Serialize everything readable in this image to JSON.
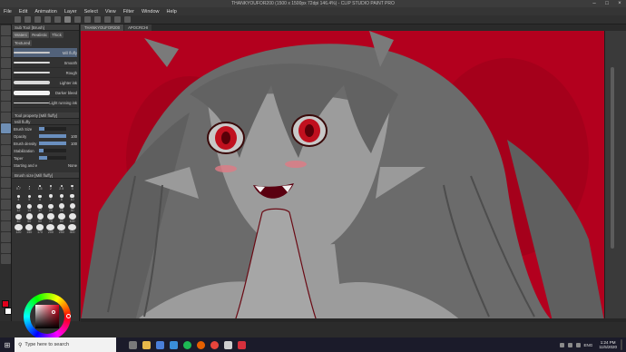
{
  "window": {
    "title": "THANKYOUFOR200 (1500 x 1500px 72dpi 146.4%) - CLIP STUDIO PAINT PRO",
    "controls": [
      "minimize-icon",
      "maximize-icon",
      "close-icon"
    ]
  },
  "menu": [
    "File",
    "Edit",
    "Animation",
    "Layer",
    "Select",
    "View",
    "Filter",
    "Window",
    "Help"
  ],
  "subtool_panel": {
    "header": "Sub Tool [Brush]",
    "tabs": [
      "Waterc",
      "Realistic",
      "Thick",
      "Textured"
    ],
    "brushes": [
      {
        "name": "Mill fluffy",
        "selected": true
      },
      {
        "name": "Smooth",
        "selected": false
      },
      {
        "name": "Rough",
        "selected": false
      },
      {
        "name": "Lighter ink",
        "selected": false
      },
      {
        "name": "Darker bleed",
        "selected": false
      },
      {
        "name": "Light running ink",
        "selected": false
      }
    ]
  },
  "tool_property": {
    "header": "Tool property [Mill fluffy]",
    "subheader": "Mill fluffy",
    "props": [
      {
        "label": "Brush Size",
        "value": "",
        "level": 0.2
      },
      {
        "label": "Opacity",
        "value": "100",
        "level": 1.0
      },
      {
        "label": "Brush density",
        "value": "100",
        "level": 1.0
      },
      {
        "label": "Stabilization",
        "value": "",
        "level": 0.15
      },
      {
        "label": "Taper",
        "value": "",
        "level": 0.3
      },
      {
        "label": "Starting and ending",
        "value": "None",
        "level": 0.0
      }
    ]
  },
  "brush_size_panel": {
    "header": "Brush size [Mill fluffy]",
    "sizes": [
      "0.7",
      "1",
      "1.5",
      "2",
      "2.5",
      "3",
      "4",
      "5",
      "6",
      "7",
      "8",
      "10",
      "12",
      "15",
      "17",
      "20",
      "25",
      "30",
      "40",
      "50",
      "60",
      "70",
      "80",
      "100",
      "120",
      "150",
      "170",
      "200",
      "250",
      "300"
    ]
  },
  "document_tabs": [
    "THANKYOUFOR200",
    "APOCRCHI"
  ],
  "colors": {
    "main": "#e0001c",
    "sub": "#ffffff",
    "canvas_bg": "#b3001e"
  },
  "taskbar": {
    "search_placeholder": "Type here to search",
    "apps": [
      "file-explorer-icon",
      "store-icon",
      "mail-icon",
      "spotify-icon",
      "firefox-icon",
      "chrome-icon",
      "app-icon",
      "clip-studio-icon"
    ],
    "language": "ENG",
    "time": "1:24 PM",
    "date": "11/5/2020"
  }
}
